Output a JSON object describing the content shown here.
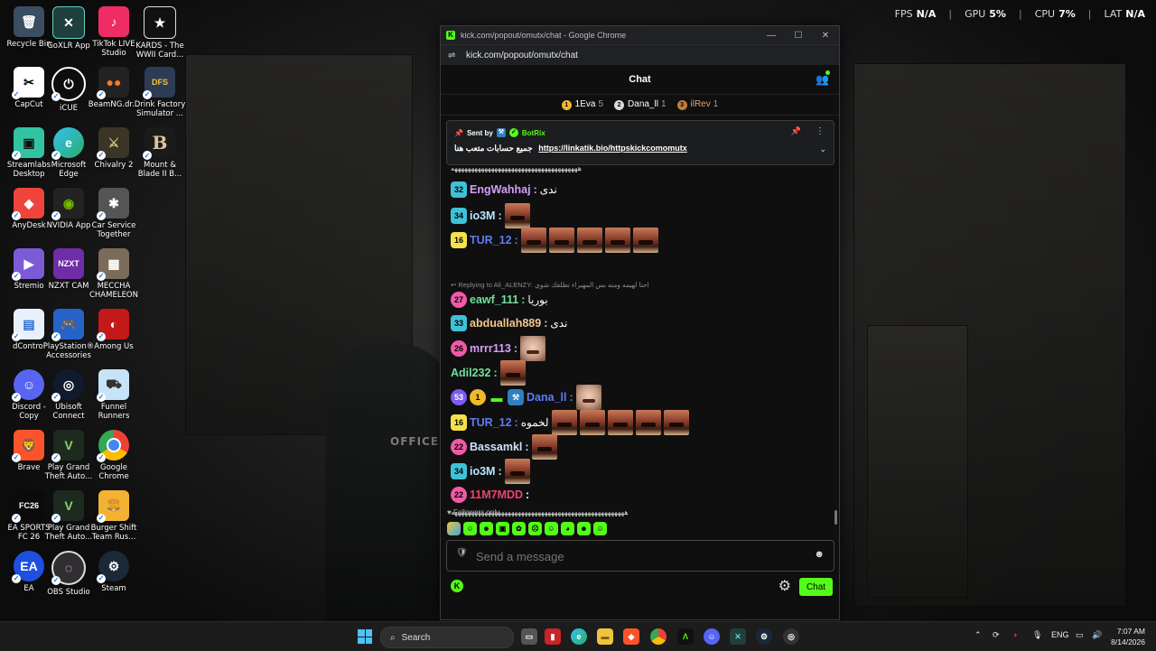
{
  "perf": {
    "fps_label": "FPS",
    "fps_value": "N/A",
    "gpu_label": "GPU",
    "gpu_value": "5%",
    "cpu_label": "CPU",
    "cpu_value": "7%",
    "lat_label": "LAT",
    "lat_value": "N/A"
  },
  "desktop_icons": {
    "col1": [
      "Recycle Bin",
      "CapCut",
      "Streamlabs\nDesktop",
      "AnyDesk",
      "Stremio",
      "dControl",
      "Discord -\nCopy",
      "Brave",
      "EA SPORTS\nFC 26",
      "EA"
    ],
    "col2": [
      "GoXLR App",
      "iCUE",
      "Microsoft\nEdge",
      "NVIDIA App",
      "NZXT CAM",
      "PlayStation®\nAccessories",
      "Ubisoft\nConnect",
      "Play Grand\nTheft Auto...",
      "Play Grand\nTheft Auto...",
      "OBS Studio"
    ],
    "col3": [
      "TikTok LIVE\nStudio",
      "BeamNG.dr...",
      "Chivalry 2",
      "Car Service\nTogether",
      "MECCHA\nCHAMELEON",
      "Among Us",
      "Funnel\nRunners",
      "Google\nChrome",
      "Burger Shift\nTeam Rus...",
      "Steam"
    ],
    "col4": [
      "KARDS - The\nWWII Card...",
      "Drink Factory\nSimulator ...",
      "Mount &\nBlade II B..."
    ]
  },
  "window": {
    "title": "kick.com/popout/omutx/chat - Google Chrome",
    "url": "kick.com/popout/omutx/chat"
  },
  "chat": {
    "header": "Chat",
    "leaders": [
      {
        "rank": "1",
        "name": "1Eva",
        "count": "5",
        "color": "#f0b92a"
      },
      {
        "rank": "2",
        "name": "Dana_ll",
        "count": "1",
        "color": "#d9d9d9"
      },
      {
        "rank": "3",
        "name": "ilRev",
        "count": "1",
        "color": "#c47b3c"
      }
    ],
    "pinned": {
      "sent_by": "Sent by",
      "bot_name": "BotRix",
      "message": "جميع حسابات متعب هنا",
      "link": "https://linkatik.bio/httpskickcomomutx"
    },
    "top_line": "ههههههههههههههههههههههههههههههههههههههه",
    "messages": [
      {
        "badge": "32",
        "badge_color": "#3fc1d6",
        "user": "EngWahhaj",
        "user_color": "#d59ef8",
        "text": "ندى",
        "emotes": 0,
        "emote_type": "none"
      },
      {
        "badge": "34",
        "badge_color": "#3fc1d6",
        "user": "io3M",
        "user_color": "#b7e6ff",
        "text": "",
        "emotes": 1,
        "emote_type": "mouth"
      },
      {
        "badge": "16",
        "badge_color": "#f5e14a",
        "user": "TUR_12",
        "user_color": "#5f7bf2",
        "text": "",
        "emotes": 5,
        "emote_type": "mouth"
      },
      {
        "badge": "27",
        "badge_color": "#f05aa8",
        "user": "eawf_111",
        "user_color": "#70e19b",
        "text": "بوريا",
        "emotes": 0,
        "emote_type": "none",
        "reply": "Replying to Ali_ALENZY: احنا لهيمه ومنه بس المهبراء تطلقك شوي"
      },
      {
        "badge": "33",
        "badge_color": "#3fc1d6",
        "user": "abduallah889",
        "user_color": "#f5c78a",
        "text": "ندى",
        "emotes": 0,
        "emote_type": "none"
      },
      {
        "badge": "26",
        "badge_color": "#f05aa8",
        "user": "mrrr113",
        "user_color": "#d59ef8",
        "text": "",
        "emotes": 1,
        "emote_type": "face"
      },
      {
        "badge": "",
        "badge_color": "",
        "user": "Adil232",
        "user_color": "#70e19b",
        "text": "",
        "emotes": 1,
        "emote_type": "mouth"
      },
      {
        "badge": "53",
        "badge_color": "#7b5cf0",
        "user": "Dana_ll",
        "user_color": "#5f7bf2",
        "text": "",
        "emotes": 1,
        "emote_type": "face",
        "extra_badges": [
          "1",
          "sub",
          "mod"
        ]
      },
      {
        "badge": "16",
        "badge_color": "#f5e14a",
        "user": "TUR_12",
        "user_color": "#5f7bf2",
        "text": "لخموه",
        "emotes": 5,
        "emote_type": "mouth"
      },
      {
        "badge": "22",
        "badge_color": "#f05aa8",
        "user": "Bassamkl",
        "user_color": "#cfe0ff",
        "text": "",
        "emotes": 1,
        "emote_type": "mouth"
      },
      {
        "badge": "34",
        "badge_color": "#3fc1d6",
        "user": "io3M",
        "user_color": "#b7e6ff",
        "text": "",
        "emotes": 1,
        "emote_type": "mouth"
      },
      {
        "badge": "22",
        "badge_color": "#f05aa8",
        "user": "11M7MDD",
        "user_color": "#e8456e",
        "text": "",
        "emotes": 0,
        "emote_type": "none"
      }
    ],
    "bottom_line": "ههههههههههههههههههههههههههههههههههههههههههههههههههههه",
    "followers_only": "Followers only",
    "input_placeholder": "Send a message",
    "send_label": "Chat"
  },
  "taskbar": {
    "search_label": "Search",
    "lang": "ENG",
    "time": "7:07 AM",
    "date": "8/14/2026"
  },
  "colors": {
    "kick_green": "#53fc18",
    "windows_blue": "#4cc2ff"
  }
}
